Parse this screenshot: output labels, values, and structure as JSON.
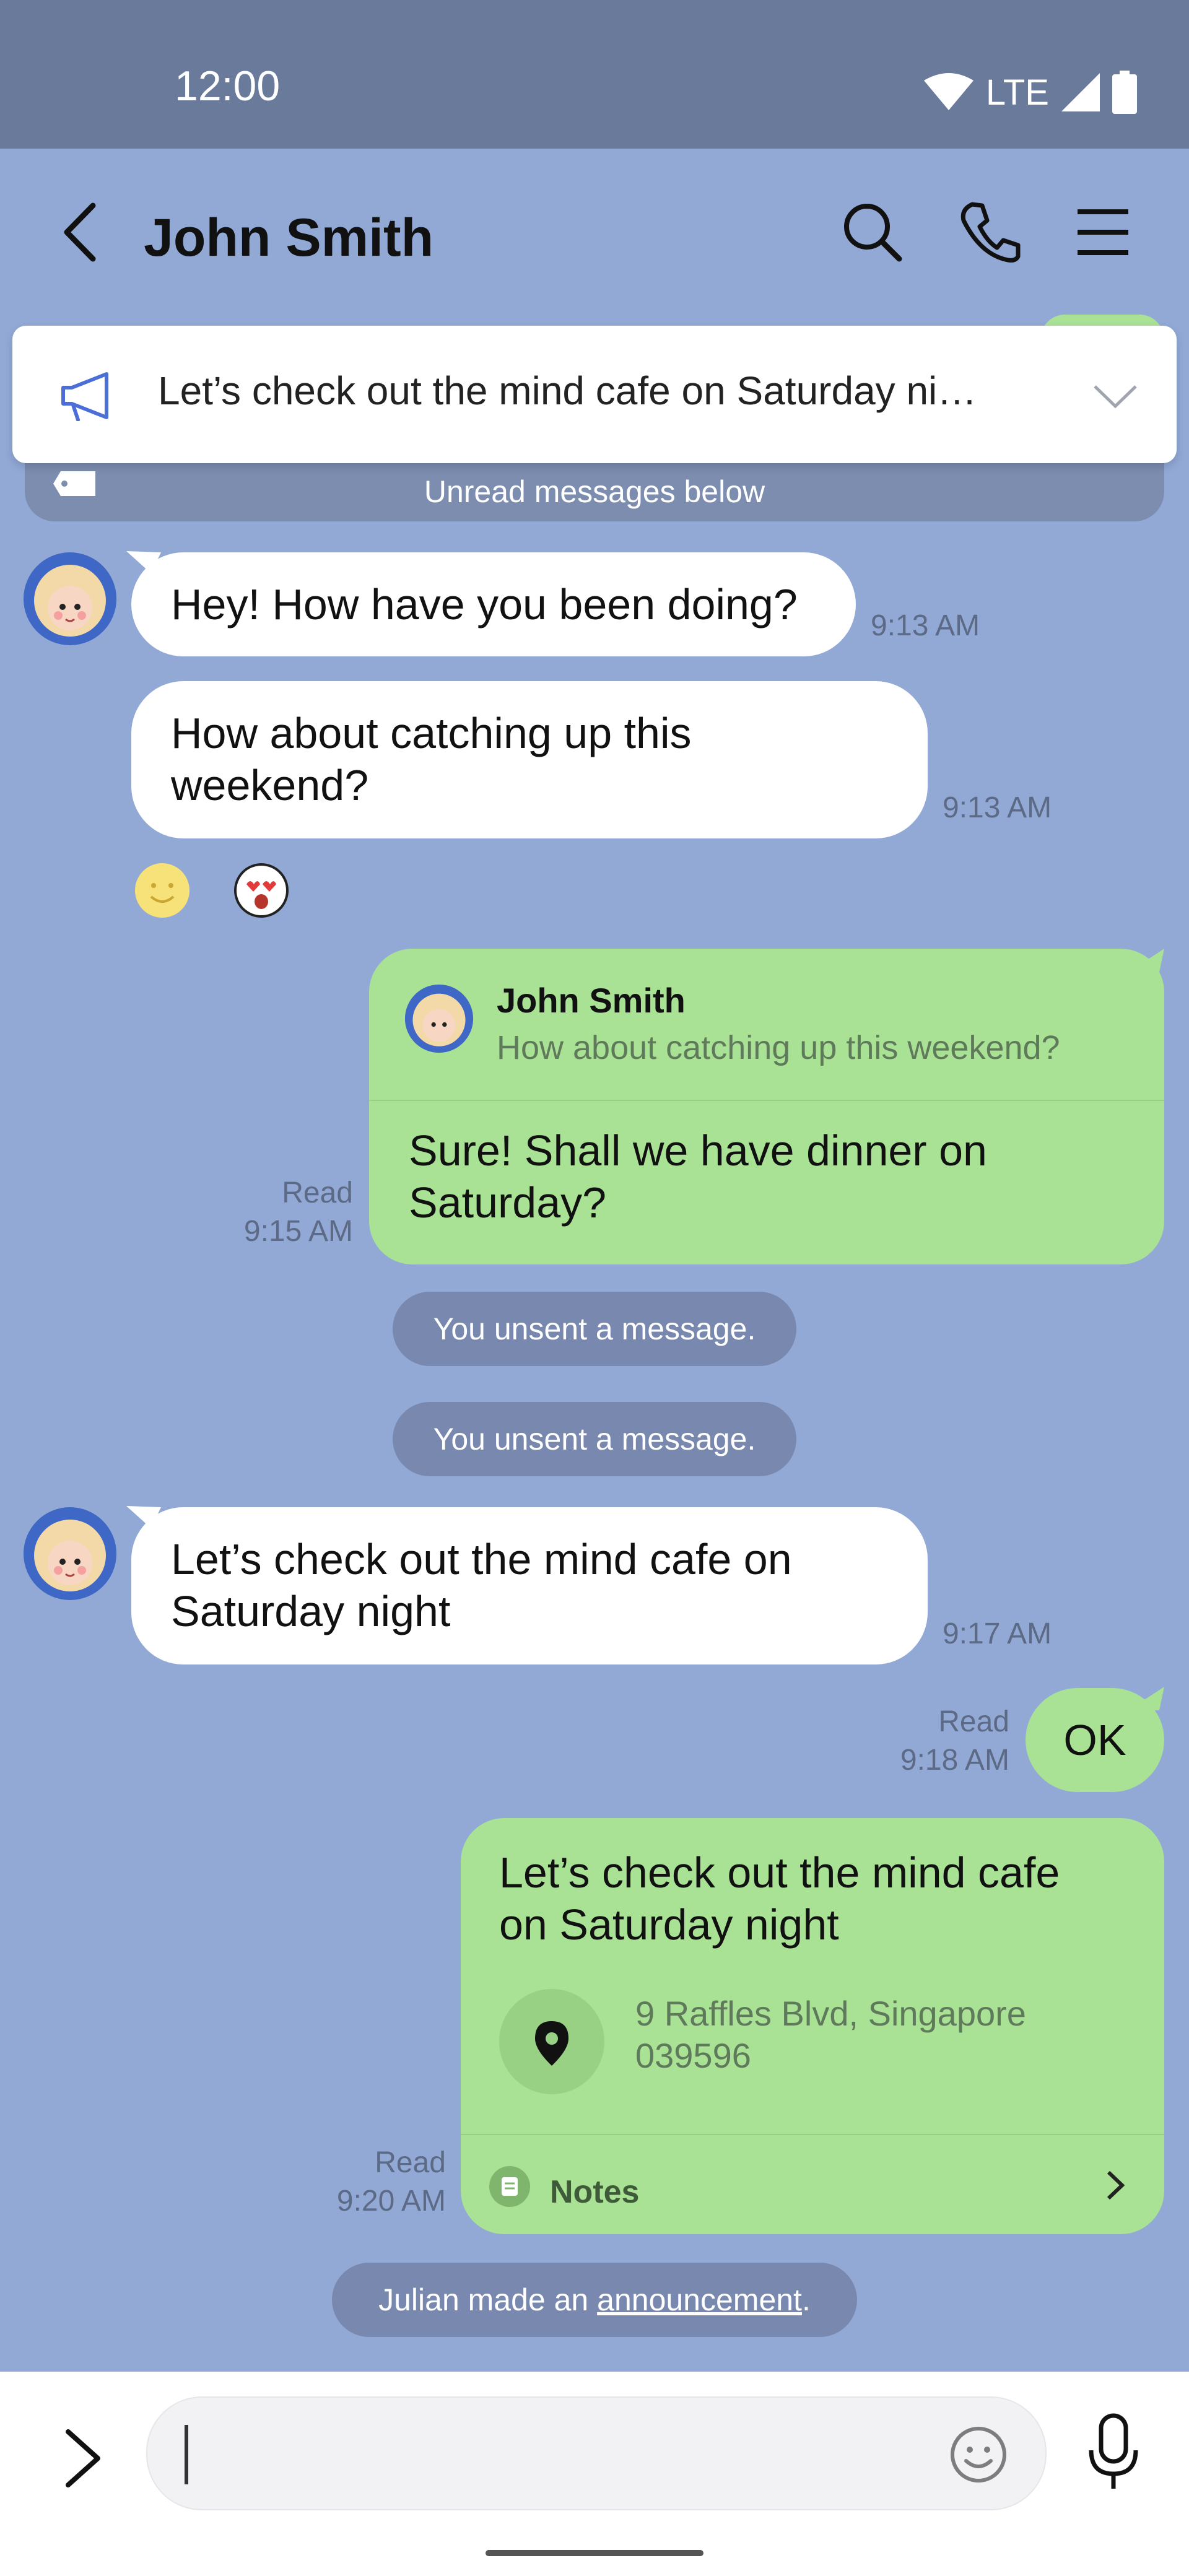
{
  "status_bar": {
    "time": "12:00",
    "network": "LTE"
  },
  "header": {
    "title": "John Smith"
  },
  "announcement": {
    "text": "Let’s check out the mind cafe on Saturday ni…"
  },
  "unread_bar": {
    "text": "Unread messages below"
  },
  "messages": [
    {
      "text": "Hey! How have you been doing?",
      "time": "9:13 AM"
    },
    {
      "line1": "How about catching up this",
      "line2": "weekend?",
      "time": "9:13 AM"
    },
    {
      "reply_name": "John Smith",
      "reply_text": "How about catching up this weekend?",
      "line1": "Sure! Shall we have dinner on",
      "line2": "Saturday?",
      "read": "Read",
      "time": "9:15 AM"
    },
    {
      "line1": "Let’s check out the mind cafe on",
      "line2": "Saturday night",
      "time": "9:17 AM"
    },
    {
      "text": "OK",
      "read": "Read",
      "time": "9:18 AM"
    },
    {
      "line1": "Let’s check out the mind cafe",
      "line2": "on Saturday night",
      "loc_line1": "9 Raffles Blvd, Singapore",
      "loc_line2": "039596",
      "notes_label": "Notes",
      "read": "Read",
      "time": "9:20 AM"
    }
  ],
  "system": {
    "unsent_1": "You unsent a message.",
    "unsent_2": "You unsent a message.",
    "announce_prefix": "Julian made an ",
    "announce_link": "announcement",
    "announce_suffix": "."
  },
  "input": {
    "placeholder": ""
  },
  "colors": {
    "background": "#92A9D6",
    "status_bar": "#6A7A9B",
    "bubble_incoming": "#FFFFFF",
    "bubble_outgoing": "#A9E195",
    "system_pill": "#7888AE",
    "avatar_ring": "#3F67C5"
  },
  "icons": {
    "header": [
      "back-arrow-icon",
      "search-icon",
      "phone-icon",
      "menu-icon"
    ],
    "announcement": "megaphone-icon",
    "reactions": [
      "smile-emoji-icon",
      "heart-eyes-emoji-icon"
    ],
    "location": "map-pin-icon",
    "notes": "notes-icon",
    "input": [
      "expand-chevron-icon",
      "emoji-icon",
      "microphone-icon"
    ]
  }
}
